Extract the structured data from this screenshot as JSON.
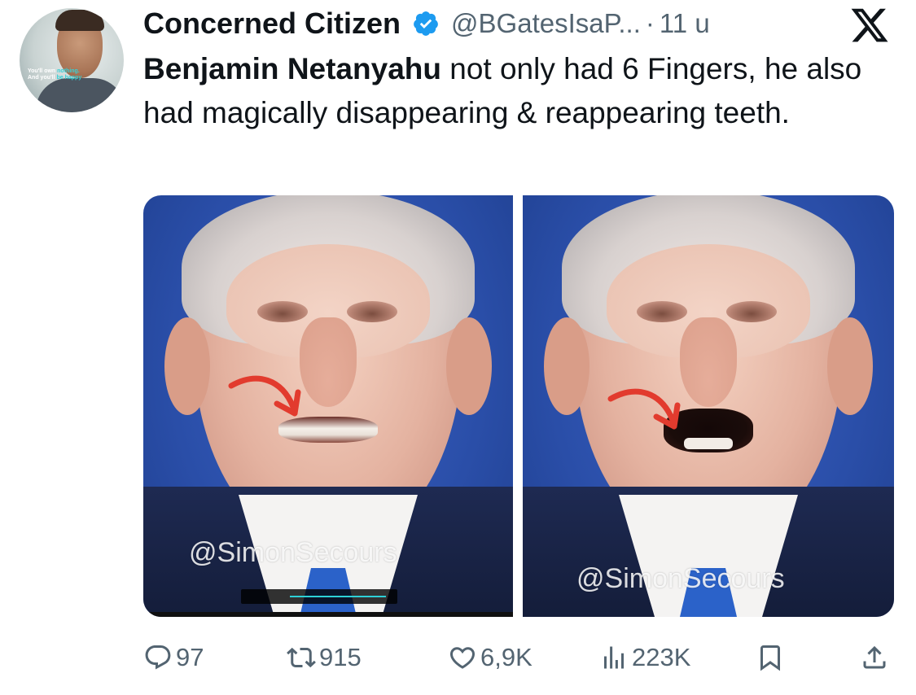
{
  "author": {
    "name": "Concerned Citizen",
    "handle": "@BGatesIsaP...",
    "separator": "·",
    "time": "11 u",
    "verified": true,
    "avatar_caption": {
      "line1_a": "You'll own ",
      "line1_b": "nothing.",
      "line2_a": "And you'll ",
      "line2_b": "be happy"
    }
  },
  "platform_icon": "x-logo-icon",
  "tweet": {
    "bold_text": "Benjamin Netanyahu",
    "text": " not only had 6 Fingers, he also had magically disappearing & reappearing teeth."
  },
  "media": {
    "left": {
      "watermark": "@SimonSecours"
    },
    "right": {
      "watermark": "@SimonSecours"
    },
    "arrow_color": "#e23b2e"
  },
  "actions": {
    "reply": {
      "icon": "reply-icon",
      "count": "97"
    },
    "retweet": {
      "icon": "retweet-icon",
      "count": "915"
    },
    "like": {
      "icon": "heart-icon",
      "count": "6,9K"
    },
    "views": {
      "icon": "views-icon",
      "count": "223K"
    },
    "bookmark": {
      "icon": "bookmark-icon"
    },
    "share": {
      "icon": "share-icon"
    }
  },
  "colors": {
    "text": "#0f1419",
    "secondary": "#536471",
    "verified": "#1d9bf0"
  }
}
